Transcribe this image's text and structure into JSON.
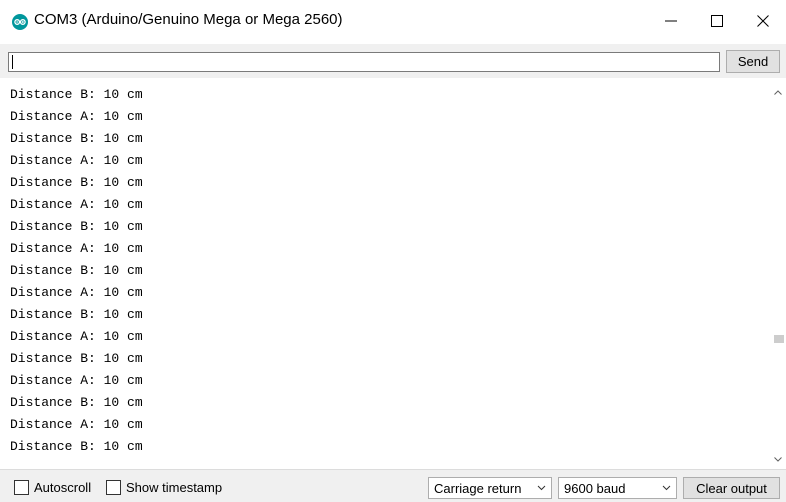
{
  "window": {
    "title": "COM3 (Arduino/Genuino Mega or Mega 2560)",
    "app_icon": "arduino-icon",
    "accent_color": "#00979c"
  },
  "send_row": {
    "input_value": "",
    "send_label": "Send"
  },
  "output": {
    "lines": [
      "Distance B: 10 cm",
      "Distance A: 10 cm",
      "Distance B: 10 cm",
      "Distance A: 10 cm",
      "Distance B: 10 cm",
      "Distance A: 10 cm",
      "Distance B: 10 cm",
      "Distance A: 10 cm",
      "Distance B: 10 cm",
      "Distance A: 10 cm",
      "Distance B: 10 cm",
      "Distance A: 10 cm",
      "Distance B: 10 cm",
      "Distance A: 10 cm",
      "Distance B: 10 cm",
      "Distance A: 10 cm",
      "Distance B: 10 cm"
    ]
  },
  "bottom_bar": {
    "autoscroll_label": "Autoscroll",
    "autoscroll_checked": false,
    "timestamp_label": "Show timestamp",
    "timestamp_checked": false,
    "line_ending": "Carriage return",
    "baud_rate": "9600 baud",
    "clear_label": "Clear output"
  }
}
